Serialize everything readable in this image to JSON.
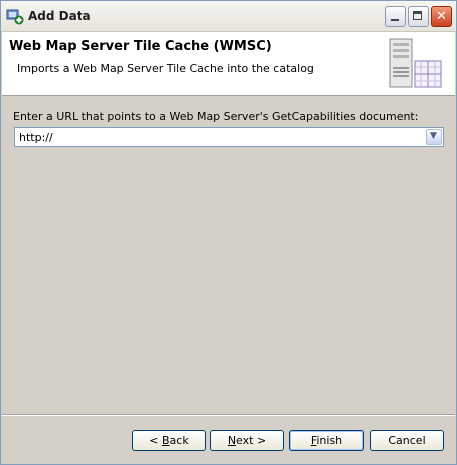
{
  "window": {
    "title": "Add Data",
    "icon": "add-data-icon",
    "controls": {
      "minimize": "minimize-icon",
      "maximize": "maximize-icon",
      "close": "close-icon"
    }
  },
  "header": {
    "title": "Web Map Server Tile Cache (WMSC)",
    "subtitle": "Imports a Web Map Server Tile Cache into the catalog",
    "icon": "server-grid-icon"
  },
  "form": {
    "url_label": "Enter a URL that points to a Web Map Server's GetCapabilities document:",
    "url_value": "http://"
  },
  "buttons": {
    "back_mnemonic": "B",
    "back_rest": "ack",
    "next_mnemonic": "N",
    "next_rest": "ext >",
    "finish_mnemonic": "F",
    "finish_rest": "inish",
    "cancel": "Cancel"
  },
  "colors": {
    "titlebar": "#ece9d8",
    "dialog_bg": "#d4d0c8",
    "close_button": "#c9411f",
    "field_border": "#7f9db9"
  }
}
